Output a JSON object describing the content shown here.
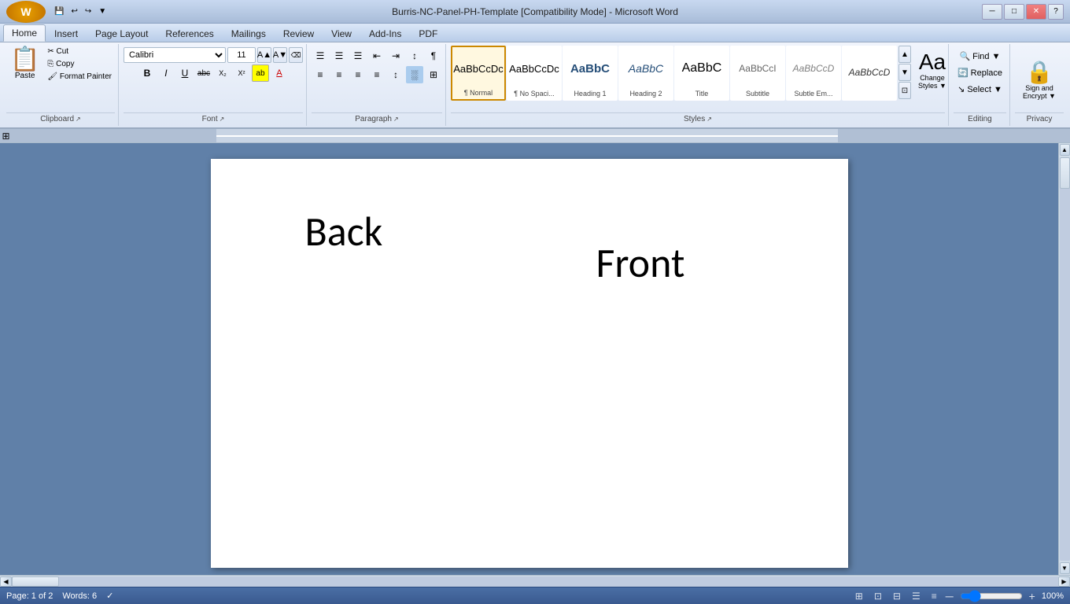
{
  "titlebar": {
    "title": "Burris-NC-Panel-PH-Template [Compatibility Mode] - Microsoft Word",
    "min_btn": "─",
    "max_btn": "□",
    "close_btn": "✕"
  },
  "quickaccess": {
    "save": "💾",
    "undo": "↩",
    "redo": "↪",
    "dropdown": "▼"
  },
  "tabs": [
    {
      "label": "Home",
      "active": true
    },
    {
      "label": "Insert",
      "active": false
    },
    {
      "label": "Page Layout",
      "active": false
    },
    {
      "label": "References",
      "active": false
    },
    {
      "label": "Mailings",
      "active": false
    },
    {
      "label": "Review",
      "active": false
    },
    {
      "label": "View",
      "active": false
    },
    {
      "label": "Add-Ins",
      "active": false
    },
    {
      "label": "PDF",
      "active": false
    }
  ],
  "groups": {
    "clipboard": {
      "label": "Clipboard",
      "paste_label": "Paste",
      "cut_label": "✂ Cut",
      "copy_label": "⎘ Copy",
      "format_painter_label": "🖌 Format Painter"
    },
    "font": {
      "label": "Font",
      "font_name": "Calibri",
      "font_size": "11",
      "grow_icon": "A▲",
      "shrink_icon": "A▼",
      "clear_icon": "⌫",
      "bold": "B",
      "italic": "I",
      "underline": "U",
      "strikethrough": "abc",
      "subscript": "X₂",
      "superscript": "X²",
      "text_color": "A",
      "highlight": "ab"
    },
    "paragraph": {
      "label": "Paragraph",
      "bullets_icon": "≡",
      "numbering_icon": "≡",
      "multi_level_icon": "≡",
      "decrease_indent": "⇤",
      "increase_indent": "⇥",
      "sort": "↕",
      "show_para": "¶",
      "align_left": "≡",
      "align_center": "≡",
      "align_right": "≡",
      "justify": "≡",
      "line_spacing": "≡",
      "shading": "░",
      "borders": "□"
    },
    "styles": {
      "label": "Styles",
      "items": [
        {
          "preview": "AaBbCcDc",
          "label": "¶ Normal",
          "active": true
        },
        {
          "preview": "AaBbCcDc",
          "label": "¶ No Spaci...",
          "active": false
        },
        {
          "preview": "AaBbC",
          "label": "Heading 1",
          "active": false
        },
        {
          "preview": "AaBbC",
          "label": "Heading 2",
          "active": false
        },
        {
          "preview": "AaBbC",
          "label": "Title",
          "active": false
        },
        {
          "preview": "AaBbCcI",
          "label": "Subtitle",
          "active": false
        },
        {
          "preview": "AaBbCcD",
          "label": "Subtle Em...",
          "active": false
        },
        {
          "preview": "AaBbCcD",
          "label": "",
          "active": false
        }
      ],
      "change_styles_label": "Change\nStyles",
      "expand_icon": "▼"
    },
    "editing": {
      "label": "Editing",
      "find_label": "🔍 Find",
      "replace_label": "Replace",
      "select_label": "↘ Select"
    },
    "privacy": {
      "label": "Privacy",
      "sign_encrypt_label": "Sign and\nEncrypt"
    }
  },
  "document": {
    "back_text": "Back",
    "front_text": "Front"
  },
  "statusbar": {
    "page_info": "Page: 1 of 2",
    "words_info": "Words: 6",
    "language_icon": "✓",
    "zoom_pct": "100%",
    "zoom_minus": "─",
    "zoom_plus": "+"
  }
}
